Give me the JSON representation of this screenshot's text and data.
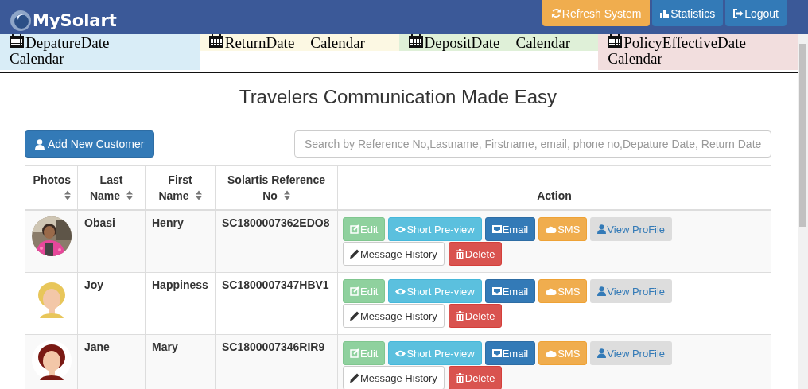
{
  "header": {
    "brand": "MySolart",
    "buttons": [
      {
        "label": "Refresh System",
        "kind": "refresh"
      },
      {
        "label": "Statistics",
        "kind": "stats"
      },
      {
        "label": "Logout",
        "kind": "logout"
      }
    ]
  },
  "calendars": [
    {
      "label": "DepatureDate",
      "suffix": "Calendar",
      "kind": "stacked",
      "color": "#d9edf7"
    },
    {
      "label": "ReturnDate",
      "suffix": "Calendar",
      "kind": "inline",
      "color": "#fcf8e3"
    },
    {
      "label": "DepositDate",
      "suffix": "Calendar",
      "kind": "inline",
      "color": "#dff0d8"
    },
    {
      "label": "PolicyEffectiveDate",
      "suffix": "Calendar",
      "kind": "stacked",
      "color": "#f2dede"
    }
  ],
  "title": "Travelers Communication Made Easy",
  "add_button": "Add New Customer",
  "search": {
    "placeholder": "Search by Reference No,Lastname, Firstname, email, phone no,Depature Date, Return Date"
  },
  "table": {
    "columns": [
      {
        "label": "Photos",
        "sortable": true
      },
      {
        "label": "Last Name",
        "sortable": true
      },
      {
        "label": "First Name",
        "sortable": true
      },
      {
        "label": "Solartis Reference No",
        "sortable": true
      },
      {
        "label": "Action",
        "sortable": false
      }
    ],
    "rows": [
      {
        "last": "Obasi",
        "first": "Henry",
        "ref": "SC1800007362EDO8",
        "actions": [
          {
            "label": "Edit",
            "kind": "edit"
          },
          {
            "label": "Short Pre-view",
            "kind": "preview"
          },
          {
            "label": "Email",
            "kind": "email"
          },
          {
            "label": "SMS",
            "kind": "sms"
          },
          {
            "label": "View ProFile",
            "kind": "profile"
          },
          {
            "label": "Message History",
            "kind": "history"
          },
          {
            "label": "Delete",
            "kind": "delete"
          }
        ]
      },
      {
        "photo": {
          "kind": "avatar",
          "color": "#e8c65a"
        },
        "last": "Joy",
        "first": "Happiness",
        "ref": "SC1800007347HBV1",
        "actions": [
          {
            "label": "Edit",
            "kind": "edit"
          },
          {
            "label": "Short Pre-view",
            "kind": "preview"
          },
          {
            "label": "Email",
            "kind": "email"
          },
          {
            "label": "SMS",
            "kind": "sms"
          },
          {
            "label": "View ProFile",
            "kind": "profile"
          },
          {
            "label": "Message History",
            "kind": "history"
          },
          {
            "label": "Delete",
            "kind": "delete"
          }
        ]
      },
      {
        "photo": {
          "kind": "avatar",
          "color": "#7a1a14"
        },
        "last": "Jane",
        "first": "Mary",
        "ref": "SC1800007346RIR9",
        "actions": [
          {
            "label": "Edit",
            "kind": "edit"
          },
          {
            "label": "Short Pre-view",
            "kind": "preview"
          },
          {
            "label": "Email",
            "kind": "email"
          },
          {
            "label": "SMS",
            "kind": "sms"
          },
          {
            "label": "View ProFile",
            "kind": "profile"
          },
          {
            "label": "Message History",
            "kind": "history"
          },
          {
            "label": "Delete",
            "kind": "delete"
          }
        ]
      }
    ]
  }
}
